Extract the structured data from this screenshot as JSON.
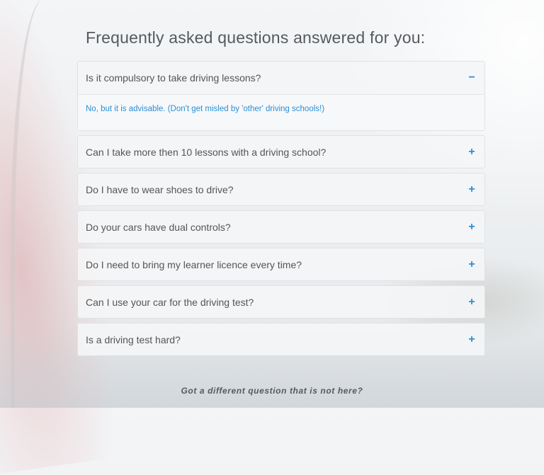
{
  "faq": {
    "title": "Frequently asked questions answered for you:",
    "items": [
      {
        "question": "Is it compulsory to take driving lessons?",
        "toggle": "−",
        "answer": "No, but it is advisable. (Don't get misled by 'other' driving schools!)"
      },
      {
        "question": "Can I take more then 10 lessons with a driving school?",
        "toggle": "+"
      },
      {
        "question": "Do I have to wear shoes to drive?",
        "toggle": "+"
      },
      {
        "question": "Do your cars have dual controls?",
        "toggle": "+"
      },
      {
        "question": "Do I need to bring my learner licence every time?",
        "toggle": "+"
      },
      {
        "question": "Can I use your car for the driving test?",
        "toggle": "+"
      },
      {
        "question": "Is a driving test hard?",
        "toggle": "+"
      }
    ],
    "footer": "Got a different question that is not here?"
  },
  "colors": {
    "accent": "#2a8fd6",
    "text": "#555555",
    "title": "#555a5f"
  }
}
